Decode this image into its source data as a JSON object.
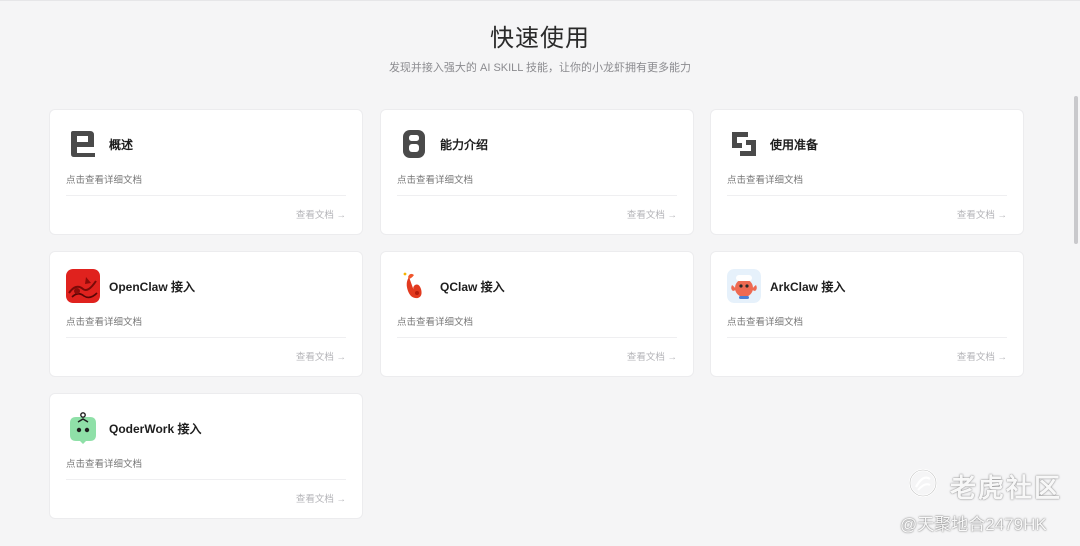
{
  "header": {
    "title": "快速使用",
    "subtitle": "发现并接入强大的 AI SKILL 技能，让你的小龙虾拥有更多能力"
  },
  "cards": [
    {
      "title": "概述",
      "desc": "点击查看详细文档",
      "link": "查看文档 →",
      "icon": "overview-icon"
    },
    {
      "title": "能力介绍",
      "desc": "点击查看详细文档",
      "link": "查看文档 →",
      "icon": "capability-icon"
    },
    {
      "title": "使用准备",
      "desc": "点击查看详细文档",
      "link": "查看文档 →",
      "icon": "preparation-icon"
    },
    {
      "title": "OpenClaw 接入",
      "desc": "点击查看详细文档",
      "link": "查看文档 →",
      "icon": "openclaw-logo-icon"
    },
    {
      "title": "QClaw 接入",
      "desc": "点击查看详细文档",
      "link": "查看文档 →",
      "icon": "qclaw-logo-icon"
    },
    {
      "title": "ArkClaw 接入",
      "desc": "点击查看详细文档",
      "link": "查看文档 →",
      "icon": "arkclaw-logo-icon"
    },
    {
      "title": "QoderWork 接入",
      "desc": "点击查看详细文档",
      "link": "查看文档 →",
      "icon": "qoderwork-logo-icon"
    }
  ],
  "watermark": {
    "brand": "老虎社区",
    "user": "@天聚地合2479HK"
  },
  "colors": {
    "background": "#f5f5f6",
    "card": "#ffffff",
    "icon_dark": "#4a4a4a",
    "openclaw_red": "#e0221e",
    "qoderwork_green": "#8fe0a8"
  }
}
